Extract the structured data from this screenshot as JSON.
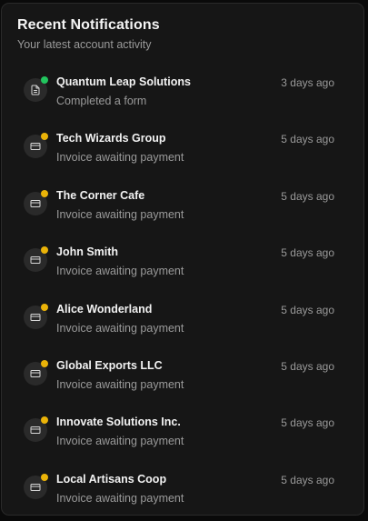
{
  "card": {
    "title": "Recent Notifications",
    "subtitle": "Your latest account activity"
  },
  "colors": {
    "dot_success": "#22c55e",
    "dot_pending": "#eab308"
  },
  "notifications": [
    {
      "name": "Quantum Leap Solutions",
      "description": "Completed a form",
      "time": "3 days ago",
      "icon": "document-icon",
      "status": "success"
    },
    {
      "name": "Tech Wizards Group",
      "description": "Invoice awaiting payment",
      "time": "5 days ago",
      "icon": "credit-card-icon",
      "status": "pending"
    },
    {
      "name": "The Corner Cafe",
      "description": "Invoice awaiting payment",
      "time": "5 days ago",
      "icon": "credit-card-icon",
      "status": "pending"
    },
    {
      "name": "John Smith",
      "description": "Invoice awaiting payment",
      "time": "5 days ago",
      "icon": "credit-card-icon",
      "status": "pending"
    },
    {
      "name": "Alice Wonderland",
      "description": "Invoice awaiting payment",
      "time": "5 days ago",
      "icon": "credit-card-icon",
      "status": "pending"
    },
    {
      "name": "Global Exports LLC",
      "description": "Invoice awaiting payment",
      "time": "5 days ago",
      "icon": "credit-card-icon",
      "status": "pending"
    },
    {
      "name": "Innovate Solutions Inc.",
      "description": "Invoice awaiting payment",
      "time": "5 days ago",
      "icon": "credit-card-icon",
      "status": "pending"
    },
    {
      "name": "Local Artisans Coop",
      "description": "Invoice awaiting payment",
      "time": "5 days ago",
      "icon": "credit-card-icon",
      "status": "pending"
    }
  ]
}
